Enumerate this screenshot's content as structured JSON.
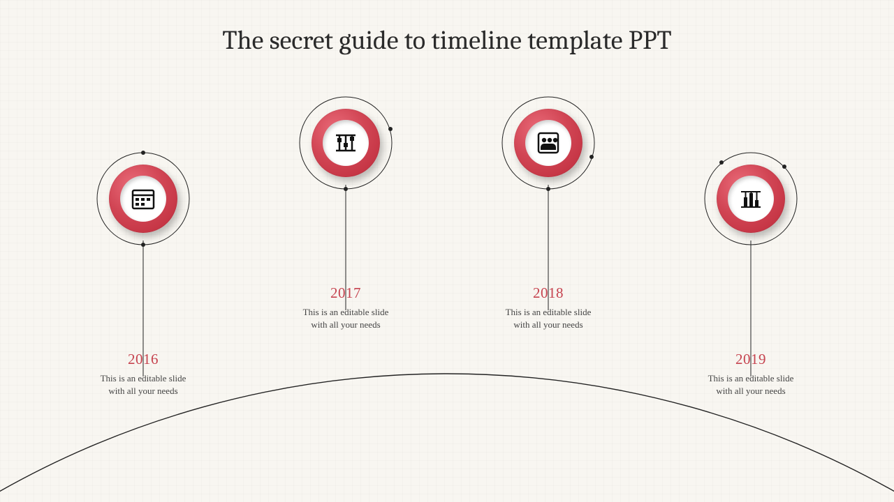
{
  "title": "The secret guide to timeline template PPT",
  "accent_color": "#c6434f",
  "nodes": [
    {
      "year": "2016",
      "desc_line1": "This is an editable slide",
      "desc_line2": "with all your needs",
      "icon": "calendar"
    },
    {
      "year": "2017",
      "desc_line1": "This is an editable slide",
      "desc_line2": "with all your needs",
      "icon": "sliders"
    },
    {
      "year": "2018",
      "desc_line1": "This is an editable slide",
      "desc_line2": "with all your needs",
      "icon": "people-frame"
    },
    {
      "year": "2019",
      "desc_line1": "This is an editable slide",
      "desc_line2": "with all your needs",
      "icon": "bar-chart"
    }
  ]
}
